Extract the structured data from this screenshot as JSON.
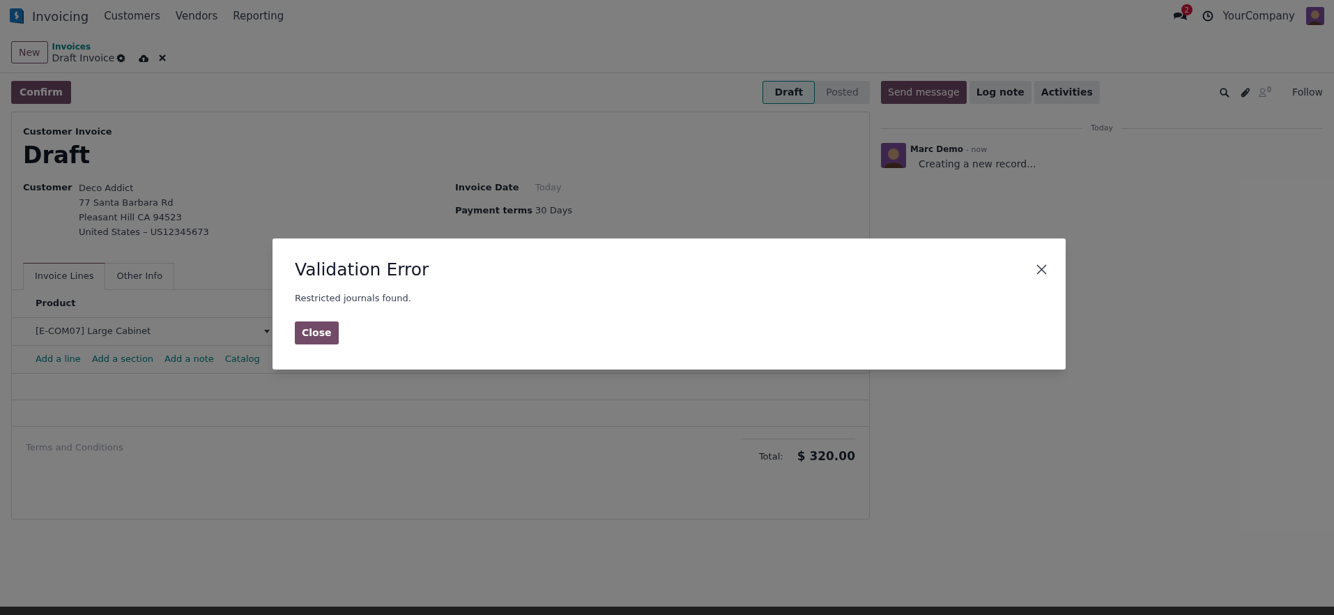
{
  "navbar": {
    "app": "Invoicing",
    "menus": [
      "Customers",
      "Vendors",
      "Reporting"
    ],
    "message_count": "2",
    "company": "YourCompany"
  },
  "control_panel": {
    "new_button": "New",
    "breadcrumb": "Invoices",
    "record": "Draft Invoice"
  },
  "statusbar": {
    "confirm_button": "Confirm",
    "stages": [
      {
        "label": "Draft",
        "selected": true
      },
      {
        "label": "Posted",
        "selected": false
      }
    ]
  },
  "form": {
    "type_label": "Customer Invoice",
    "title": "Draft",
    "customer_label": "Customer",
    "customer_lines": [
      "Deco Addict",
      "77 Santa Barbara Rd",
      "Pleasant Hill CA 94523",
      "United States – US12345673"
    ],
    "fields": [
      {
        "label": "Invoice Date",
        "value": "Today",
        "placeholder": true
      },
      {
        "label": "Payment terms",
        "value": "30 Days",
        "placeholder": false
      }
    ],
    "tabs": [
      {
        "label": "Invoice Lines",
        "selected": true
      },
      {
        "label": "Other Info",
        "selected": false
      }
    ],
    "table": {
      "columns": [
        "Product"
      ],
      "rows": [
        [
          "[E-COM07] Large Cabinet"
        ]
      ]
    },
    "add_links": [
      "Add a line",
      "Add a section",
      "Add a note",
      "Catalog"
    ],
    "terms_placeholder": "Terms and Conditions",
    "total_label": "Total:",
    "total": "$ 320.00"
  },
  "chatter": {
    "buttons": [
      {
        "label": "Send message",
        "selected": true
      },
      {
        "label": "Log note",
        "selected": false
      },
      {
        "label": "Activities",
        "selected": false
      }
    ],
    "follower_count": "0",
    "follow": "Follow",
    "date_separator": "Today",
    "messages": [
      {
        "author": "Marc Demo",
        "time": "- now",
        "body": "Creating a new record..."
      }
    ]
  },
  "dialog": {
    "title": "Validation Error",
    "message": "Restricted journals found.",
    "button": "Close"
  }
}
